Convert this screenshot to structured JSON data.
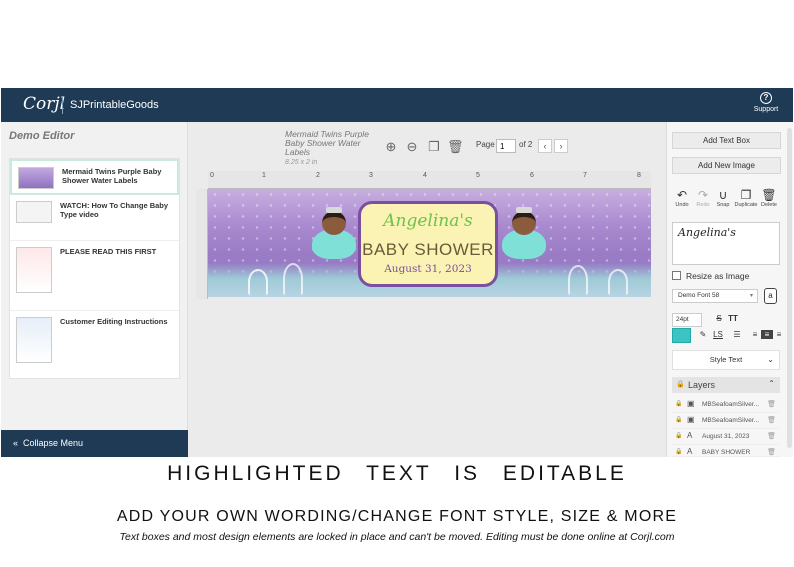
{
  "app": {
    "logo": "Corjl",
    "shop_name": "SJPrintableGoods",
    "support_label": "Support"
  },
  "left_panel": {
    "title": "Demo Editor",
    "templates": [
      {
        "label": "Mermaid Twins Purple Baby Shower Water Labels"
      },
      {
        "label": "WATCH: How To Change Baby Type video"
      },
      {
        "label": "PLEASE READ THIS FIRST"
      },
      {
        "label": "Customer Editing Instructions"
      }
    ],
    "collapse_label": "Collapse Menu"
  },
  "document": {
    "name": "Mermaid Twins Purple Baby Shower Water Labels",
    "size": "8.25 x 2 in",
    "page_label": "Page",
    "page_current": "1",
    "page_of": "of 2",
    "ruler_numbers": [
      "0",
      "1",
      "2",
      "3",
      "4",
      "5",
      "6",
      "7",
      "8"
    ]
  },
  "design": {
    "name_text": "Angelina's",
    "title_text": "BABY SHOWER",
    "date_text": "August 31, 2023"
  },
  "right_panel": {
    "add_text_label": "Add Text Box",
    "add_image_label": "Add New Image",
    "tools": [
      {
        "label": "Undo",
        "icon": "undo-icon"
      },
      {
        "label": "Redo",
        "icon": "redo-icon"
      },
      {
        "label": "Snap",
        "icon": "magnet-icon"
      },
      {
        "label": "Duplicate",
        "icon": "duplicate-icon"
      },
      {
        "label": "Delete",
        "icon": "trash-icon"
      }
    ],
    "text_value": "Angelina's",
    "resize_label": "Resize as Image",
    "font_name": "Demo Font 58",
    "font_size": "24pt",
    "color": "#3ec3c3",
    "style_text_label": "Style Text",
    "layers_label": "Layers",
    "layers": [
      {
        "label": "MBSeafoamSilver...",
        "type": "image"
      },
      {
        "label": "MBSeafoamSilver...",
        "type": "image"
      },
      {
        "label": "August 31, 2023",
        "type": "text"
      },
      {
        "label": "BABY SHOWER",
        "type": "text"
      }
    ]
  },
  "captions": {
    "headline": "HIGHLIGHTED TEXT IS EDITABLE",
    "subheadline": "ADD YOUR OWN WORDING/CHANGE FONT STYLE, SIZE & MORE",
    "note": "Text boxes and most design elements are locked in place and can't be moved. Editing must be done online at Corjl.com"
  }
}
